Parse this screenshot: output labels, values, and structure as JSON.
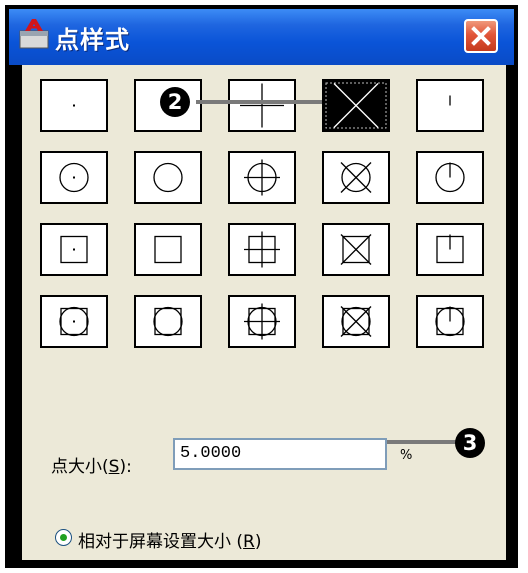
{
  "window": {
    "title": "点样式",
    "app_icon": "autocad-a-icon",
    "close_icon": "close-x-icon"
  },
  "styles": [
    {
      "id": "dot"
    },
    {
      "id": "none"
    },
    {
      "id": "plus"
    },
    {
      "id": "x"
    },
    {
      "id": "tick"
    },
    {
      "id": "circle-dot"
    },
    {
      "id": "circle"
    },
    {
      "id": "circle-plus"
    },
    {
      "id": "circle-x"
    },
    {
      "id": "circle-tick"
    },
    {
      "id": "square-dot"
    },
    {
      "id": "square"
    },
    {
      "id": "square-plus"
    },
    {
      "id": "square-x"
    },
    {
      "id": "square-tick"
    },
    {
      "id": "circsq-dot"
    },
    {
      "id": "circsq"
    },
    {
      "id": "circsq-plus"
    },
    {
      "id": "circsq-x"
    },
    {
      "id": "circsq-tick"
    }
  ],
  "selected_style": "x",
  "size": {
    "label_prefix": "点大小(",
    "label_key": "S",
    "label_suffix": "):",
    "value": "5.0000",
    "unit": "%"
  },
  "mode": {
    "label_prefix": "相对于屏幕设置大小 (",
    "label_key": "R",
    "label_suffix": ")"
  },
  "callouts": {
    "grid": "2",
    "size": "3"
  },
  "colors": {
    "title_bar": "#0a54d8",
    "dialog_bg": "#ece9d8",
    "close_button": "#e2563a",
    "radio_dot": "#21a121"
  }
}
